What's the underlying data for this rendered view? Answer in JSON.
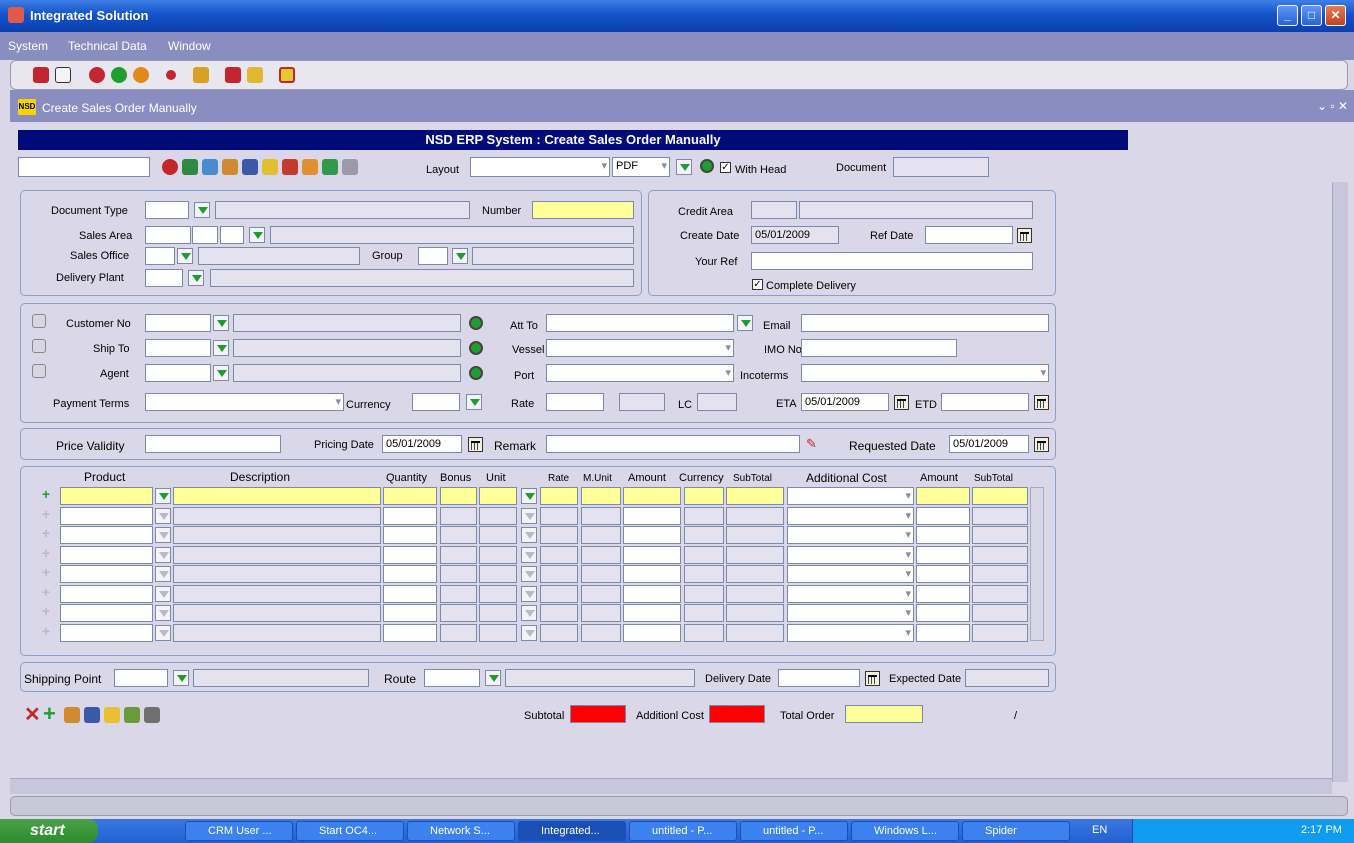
{
  "window": {
    "title": "Integrated Solution"
  },
  "menu": [
    "System",
    "Technical Data",
    "Window"
  ],
  "form": {
    "title": "Create Sales Order Manually",
    "header": "NSD ERP System : Create Sales Order Manually",
    "logo": "NSD"
  },
  "toolbar2": {
    "layout_label": "Layout",
    "format_value": "PDF",
    "with_head_label": "With Head",
    "document_label": "Document"
  },
  "sections": {
    "doc": {
      "document_type": "Document Type",
      "number": "Number",
      "sales_area": "Sales Area",
      "sales_office": "Sales Office",
      "group": "Group",
      "delivery_plant": "Delivery Plant"
    },
    "credit": {
      "credit_area": "Credit Area",
      "create_date": "Create Date",
      "create_date_value": "05/01/2009",
      "ref_date": "Ref Date",
      "your_ref": "Your Ref",
      "complete_delivery": "Complete Delivery"
    },
    "customer": {
      "customer_no": "Customer No",
      "ship_to": "Ship To",
      "agent": "Agent",
      "att_to": "Att To",
      "email": "Email",
      "vessel": "Vessel",
      "imo_no": "IMO No",
      "port": "Port",
      "incoterms": "Incoterms",
      "payment_terms": "Payment Terms",
      "currency": "Currency",
      "rate": "Rate",
      "lc": "LC",
      "eta": "ETA",
      "eta_value": "05/01/2009",
      "etd": "ETD"
    },
    "pricing": {
      "price_validity": "Price Validity",
      "pricing_date": "Pricing Date",
      "pricing_date_value": "05/01/2009",
      "remark": "Remark",
      "requested_date": "Requested Date",
      "requested_date_value": "05/01/2009"
    },
    "shipping": {
      "shipping_point": "Shipping Point",
      "route": "Route",
      "delivery_date": "Delivery Date",
      "expected_date": "Expected Date"
    },
    "totals": {
      "subtotal": "Subtotal",
      "additional_cost": "Additionl Cost",
      "total_order": "Total Order",
      "slash": "/"
    }
  },
  "grid": {
    "columns": [
      "Product",
      "Description",
      "Quantity",
      "Bonus",
      "Unit",
      "Rate",
      "M.Unit",
      "Amount",
      "Currency",
      "SubTotal",
      "Additional Cost",
      "Amount",
      "SubTotal"
    ]
  },
  "taskbar": {
    "start": "start",
    "tasks": [
      "CRM User ...",
      "Start OC4...",
      "Network S...",
      "Integrated...",
      "untitled - P...",
      "untitled - P...",
      "Windows L...",
      "Spider"
    ],
    "lang": "EN",
    "time": "2:17 PM"
  },
  "colors": {
    "titlebar": "#1453c9",
    "panel": "#dad8e8",
    "header": "#000a78",
    "required": "#ffff99",
    "alert": "#ff0000"
  }
}
